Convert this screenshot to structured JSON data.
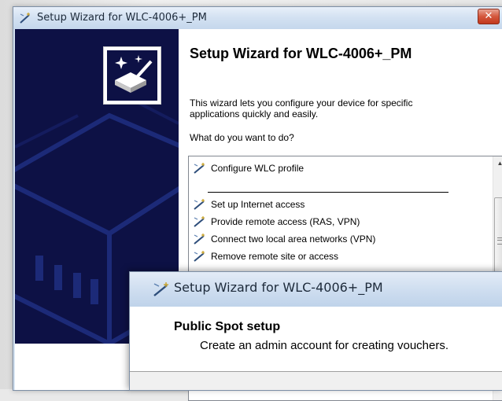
{
  "background_window": {
    "title": "Setup Wizard for WLC-4006+_PM",
    "close_glyph": "✕",
    "heading": "Setup Wizard for WLC-4006+_PM",
    "intro": "This wizard lets you configure your device for specific applications quickly and easily.",
    "question": "What do you want to do?",
    "options": [
      "Configure WLC profile",
      "Set up Internet access",
      "Provide remote access (RAS, VPN)",
      "Connect two local area networks (VPN)",
      "Remove remote site or access"
    ],
    "scroll_up_glyph": "▲",
    "icons": {
      "title": "wizard-wand-icon",
      "option": "wizard-wand-icon",
      "logo": "wizard-device-logo"
    }
  },
  "dialog": {
    "title": "Setup Wizard for WLC-4006+_PM",
    "heading": "Public Spot setup",
    "subheading": "Create an admin account for creating vouchers."
  },
  "colors": {
    "side_panel": "#0d1145",
    "titlebar": "#d4e2f2",
    "close_button": "#d4573c"
  }
}
